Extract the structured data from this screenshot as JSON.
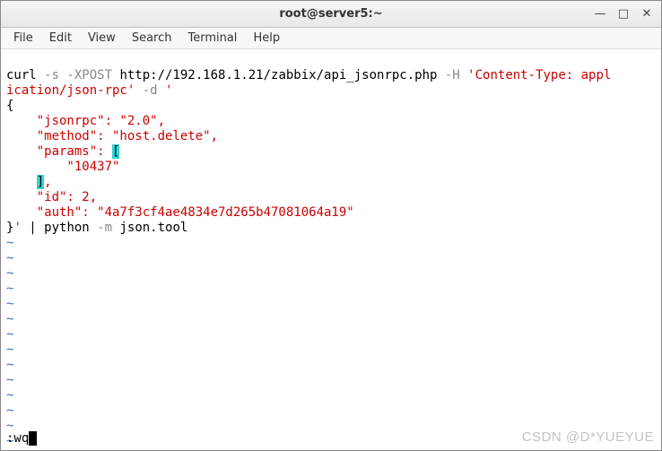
{
  "window": {
    "title": "root@server5:~",
    "controls": {
      "minimize": "—",
      "maximize": "□",
      "close": "✕"
    }
  },
  "menu": {
    "file": "File",
    "edit": "Edit",
    "view": "View",
    "search": "Search",
    "terminal": "Terminal",
    "help": "Help"
  },
  "code": {
    "l1a": "curl",
    "l1b": " -s -XPOST",
    "l1c": " http://192.168.1.21/zabbix/api_jsonrpc.php",
    "l1d": " -H ",
    "l1e": "'Content-Type: appl",
    "l2a": "ication/json-rpc'",
    "l2b": " -d ",
    "l2c": "'",
    "l3": "{",
    "l4a": "    \"jsonrpc\": \"2.0\",",
    "l5a": "    \"method\": \"host.delete\",",
    "l6a": "    \"params\": ",
    "l6b": "[",
    "l7a": "        \"10437\"",
    "l8a": "    ",
    "l8b": "]",
    "l8c": ",",
    "l9a": "    \"id\": 2,",
    "l10a": "    \"auth\": \"4a7f3cf4ae4834e7d265b47081064a19\"",
    "l11a": "}",
    "l11b": "'",
    "l11c": " | python",
    "l11d": " -m",
    "l11e": " json.tool",
    "tilde": "~"
  },
  "status": {
    "cmd": ":wq"
  },
  "watermark": "CSDN @D*YUEYUE"
}
